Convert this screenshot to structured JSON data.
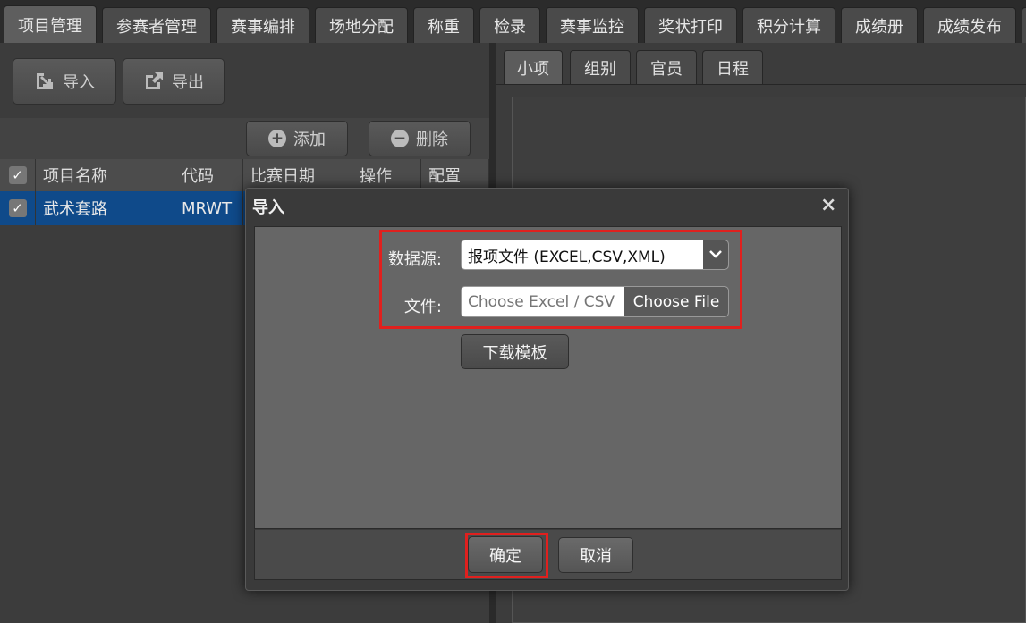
{
  "top_tabs": [
    {
      "label": "项目管理",
      "active": true
    },
    {
      "label": "参赛者管理"
    },
    {
      "label": "赛事编排"
    },
    {
      "label": "场地分配"
    },
    {
      "label": "称重"
    },
    {
      "label": "检录"
    },
    {
      "label": "赛事监控"
    },
    {
      "label": "奖状打印"
    },
    {
      "label": "积分计算"
    },
    {
      "label": "成绩册"
    },
    {
      "label": "成绩发布"
    }
  ],
  "left": {
    "import_label": "导入",
    "export_label": "导出",
    "add_label": "添加",
    "delete_label": "删除",
    "columns": [
      "项目名称",
      "代码",
      "比赛日期",
      "操作",
      "配置"
    ],
    "rows": [
      {
        "name": "武术套路",
        "code": "MRWT"
      }
    ]
  },
  "right": {
    "tabs": [
      "小项",
      "组别",
      "官员",
      "日程"
    ]
  },
  "dialog": {
    "title": "导入",
    "close": "×",
    "source_label": "数据源:",
    "source_value": "报项文件 (EXCEL,CSV,XML)",
    "file_label": "文件:",
    "file_placeholder": "Choose Excel / CSV / XML",
    "choose_file": "Choose File",
    "template_label": "下载模板",
    "ok_label": "确定",
    "cancel_label": "取消"
  },
  "colors": {
    "highlight": "#e0201e",
    "selected_row": "#0f4a8a"
  }
}
